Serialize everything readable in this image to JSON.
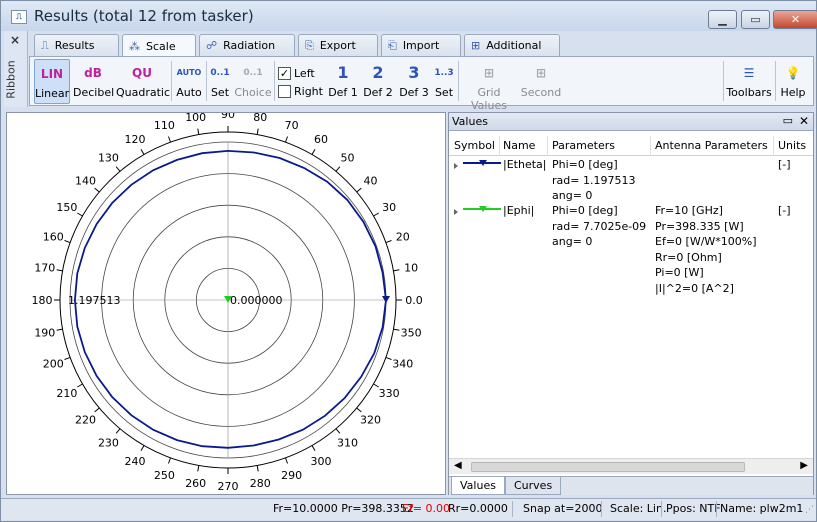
{
  "window": {
    "title": "Results (total 12 from tasker)",
    "min_icon": "minimize-icon",
    "max_icon": "maximize-icon",
    "close_icon": "close-icon"
  },
  "side": {
    "label": "Ribbon",
    "close": "×"
  },
  "tabs": [
    {
      "label": "Results",
      "icon": "results-icon"
    },
    {
      "label": "Scale",
      "icon": "scale-icon",
      "active": true
    },
    {
      "label": "Radiation",
      "icon": "radiation-icon"
    },
    {
      "label": "Export",
      "icon": "export-icon"
    },
    {
      "label": "Import",
      "icon": "import-icon"
    },
    {
      "label": "Additional",
      "icon": "additional-icon"
    }
  ],
  "ribbon": {
    "linear": {
      "label": "Linear",
      "icon_text": "LIN"
    },
    "decibel": {
      "label": "Decibel",
      "icon_text": "dB"
    },
    "quadratic": {
      "label": "Quadratic",
      "icon_text": "QU"
    },
    "auto": {
      "label": "Auto",
      "icon_text": "AUTO"
    },
    "set1": {
      "label": "Set",
      "icon_text": "0..1"
    },
    "choice": {
      "label": "Choice",
      "icon_text": "0..1"
    },
    "left": {
      "label": "Left",
      "checked": true
    },
    "right": {
      "label": "Right",
      "checked": false
    },
    "def1": {
      "label": "Def 1",
      "icon_text": "1"
    },
    "def2": {
      "label": "Def 2",
      "icon_text": "2"
    },
    "def3": {
      "label": "Def 3",
      "icon_text": "3"
    },
    "set2": {
      "label": "Set",
      "icon_text": "1..3"
    },
    "grid_values": {
      "label": "Grid Values"
    },
    "second": {
      "label": "Second"
    },
    "toolbars": {
      "label": "Toolbars"
    },
    "help": {
      "label": "Help"
    }
  },
  "plot": {
    "angle_labels": [
      "0.0",
      "10",
      "20",
      "30",
      "40",
      "50",
      "60",
      "70",
      "80",
      "90",
      "100",
      "110",
      "120",
      "130",
      "140",
      "150",
      "160",
      "170",
      "180",
      "190",
      "200",
      "210",
      "220",
      "230",
      "240",
      "250",
      "260",
      "270",
      "280",
      "290",
      "300",
      "310",
      "320",
      "330",
      "340",
      "350"
    ],
    "max_label": "1.197513",
    "center_label": "0.000000",
    "series": [
      {
        "name": "|Etheta|",
        "color": "#0a1a8c",
        "marker": "▼"
      },
      {
        "name": "|Ephi|",
        "color": "#22cc22",
        "marker": "▼"
      }
    ]
  },
  "values": {
    "title": "Values",
    "columns": [
      "Symbol",
      "Name",
      "Parameters",
      "Antenna Parameters",
      "Units"
    ],
    "rows": [
      {
        "name": "|Etheta|",
        "params": [
          "Phi=0 [deg]",
          "rad= 1.197513",
          "ang= 0"
        ],
        "antenna": [],
        "units": "[-]"
      },
      {
        "name": "|Ephi|",
        "params": [
          "Phi=0 [deg]",
          "rad= 7.7025e-09",
          "ang= 0"
        ],
        "antenna": [
          "Fr=10 [GHz]",
          "Pr=398.335 [W]",
          "Ef=0 [W/W*100%]",
          "Rr=0 [Ohm]",
          "Pi=0 [W]",
          "|I|^2=0 [A^2]"
        ],
        "units": "[-]"
      }
    ],
    "bottom_tabs": [
      "Values",
      "Curves"
    ]
  },
  "status": {
    "fr_pr": "Fr=10.0000 Pr=398.3352",
    "ef": "Ef= 0.00",
    "rr": "Rr=0.0000",
    "snap": "Snap at=2000",
    "scale": "Scale: Lin.",
    "ppos": "Ppos: NTF",
    "name": "Name: plw2m1",
    "ef_color": "#e00000"
  },
  "chart_data": {
    "type": "line",
    "title": "",
    "xlabel": "",
    "ylabel": "",
    "x": [
      0,
      10,
      20,
      30,
      40,
      50,
      60,
      70,
      80,
      90,
      100,
      110,
      120,
      130,
      140,
      150,
      160,
      170,
      180,
      190,
      200,
      210,
      220,
      230,
      240,
      250,
      260,
      270,
      280,
      290,
      300,
      310,
      320,
      330,
      340,
      350,
      360
    ],
    "series": [
      {
        "name": "|Etheta|",
        "values": [
          1.1975,
          1.19,
          1.19,
          1.185,
          1.18,
          1.17,
          1.155,
          1.145,
          1.135,
          1.13,
          1.13,
          1.13,
          1.135,
          1.14,
          1.145,
          1.15,
          1.155,
          1.16,
          1.16,
          1.16,
          1.155,
          1.15,
          1.145,
          1.14,
          1.135,
          1.13,
          1.125,
          1.12,
          1.12,
          1.125,
          1.135,
          1.145,
          1.155,
          1.165,
          1.18,
          1.19,
          1.1975
        ]
      },
      {
        "name": "|Ephi|",
        "values": [
          7.7025e-09
        ]
      }
    ],
    "ylim": [
      0,
      1.197513
    ]
  }
}
